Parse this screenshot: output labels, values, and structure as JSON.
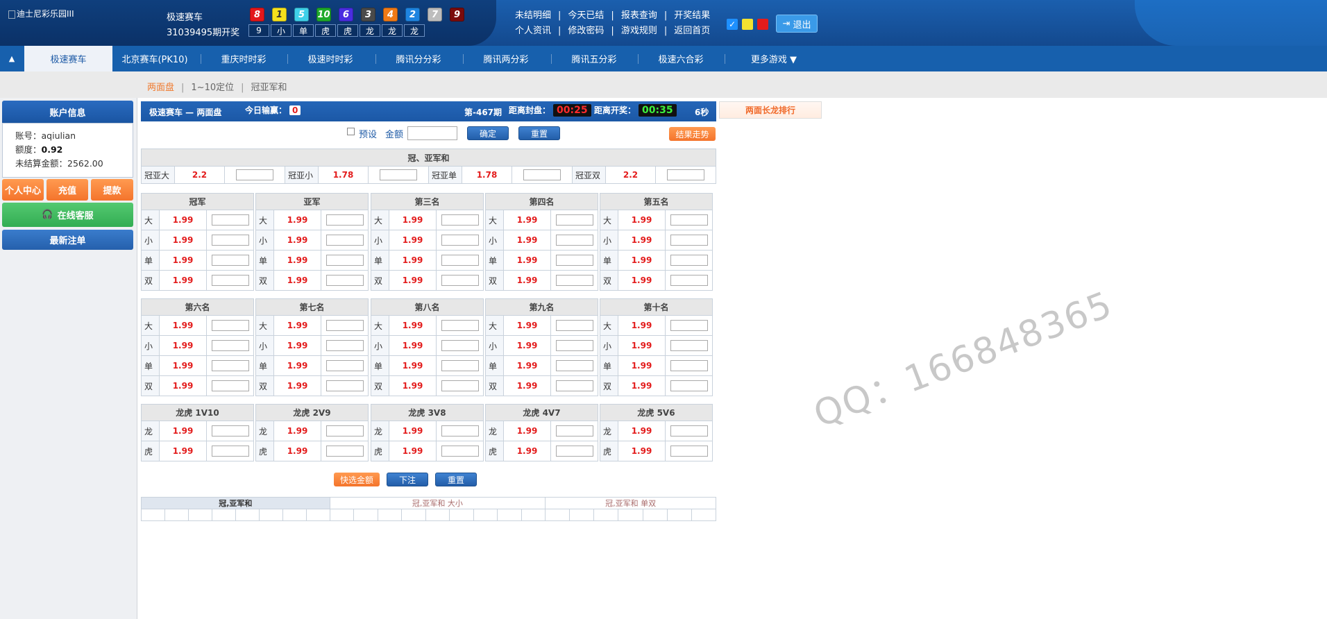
{
  "header": {
    "logo_alt": "迪士尼彩乐园III",
    "game_name": "极速赛车",
    "issue_text": "31039495期开奖",
    "balls": [
      {
        "n": "8",
        "color": "#e3171b"
      },
      {
        "n": "1",
        "color": "#f5e11d"
      },
      {
        "n": "5",
        "color": "#3fd0e9"
      },
      {
        "n": "10",
        "color": "#1faa2a"
      },
      {
        "n": "6",
        "color": "#4a2de0"
      },
      {
        "n": "3",
        "color": "#4a4a4a"
      },
      {
        "n": "4",
        "color": "#f07a16"
      },
      {
        "n": "2",
        "color": "#1e84e0"
      },
      {
        "n": "7",
        "color": "#bdbdbd"
      },
      {
        "n": "9",
        "color": "#7a0b0b"
      }
    ],
    "stats": [
      "9",
      "小",
      "单",
      "虎",
      "虎",
      "龙",
      "龙",
      "龙"
    ],
    "links_row1": [
      "未结明细",
      "今天已结",
      "报表查询",
      "开奖结果"
    ],
    "links_row2": [
      "个人资讯",
      "修改密码",
      "游戏规则",
      "返回首页"
    ],
    "swatches": [
      "#1e90ff",
      "#f2e230",
      "#e31c1c"
    ],
    "logout": "退出"
  },
  "nav": {
    "items": [
      "极速赛车",
      "北京赛车(PK10)",
      "重庆时时彩",
      "极速时时彩",
      "腾讯分分彩",
      "腾讯两分彩",
      "腾讯五分彩",
      "极速六合彩",
      "更多游戏 ▼"
    ]
  },
  "subnav": {
    "items": [
      "两面盘",
      "1~10定位",
      "冠亚军和"
    ]
  },
  "account": {
    "title": "账户信息",
    "account_label": "账号：",
    "account": "aqiulian",
    "quota_label": "额度：",
    "quota": "0.92",
    "unsettled_label": "未结算金额：",
    "unsettled": "2562.00",
    "btn_personal": "个人中心",
    "btn_deposit": "充值",
    "btn_withdraw": "提款",
    "btn_service": "在线客服",
    "btn_latest": "最新注单"
  },
  "bar": {
    "title": "极速赛车 — 两面盘",
    "today_label": "今日输赢：",
    "today_value": "0",
    "period": "第-467期",
    "close_label": "距离封盘：",
    "close_time": "00:25",
    "open_label": "距离开奖：",
    "open_time": "00:35",
    "refresh": "6秒",
    "long_dragon": "两面长龙排行"
  },
  "controls": {
    "preset": "预设",
    "amount": "金额",
    "confirm": "确定",
    "reset": "重置",
    "trend": "结果走势",
    "quick": "快选金额",
    "bet": "下注",
    "reset2": "重置"
  },
  "guanya": {
    "title": "冠、亚军和",
    "items": [
      {
        "label": "冠亚大",
        "odds": "2.2"
      },
      {
        "label": "冠亚小",
        "odds": "1.78"
      },
      {
        "label": "冠亚单",
        "odds": "1.78"
      },
      {
        "label": "冠亚双",
        "odds": "2.2"
      }
    ]
  },
  "positions1": {
    "titles": [
      "冠军",
      "亚军",
      "第三名",
      "第四名",
      "第五名"
    ],
    "rows": [
      {
        "label": "大",
        "odds": "1.99"
      },
      {
        "label": "小",
        "odds": "1.99"
      },
      {
        "label": "单",
        "odds": "1.99"
      },
      {
        "label": "双",
        "odds": "1.99"
      }
    ]
  },
  "positions2": {
    "titles": [
      "第六名",
      "第七名",
      "第八名",
      "第九名",
      "第十名"
    ],
    "rows": [
      {
        "label": "大",
        "odds": "1.99"
      },
      {
        "label": "小",
        "odds": "1.99"
      },
      {
        "label": "单",
        "odds": "1.99"
      },
      {
        "label": "双",
        "odds": "1.99"
      }
    ]
  },
  "dragon": {
    "titles": [
      "龙虎 1V10",
      "龙虎 2V9",
      "龙虎 3V8",
      "龙虎 4V7",
      "龙虎 5V6"
    ],
    "rows": [
      {
        "label": "龙",
        "odds": "1.99"
      },
      {
        "label": "虎",
        "odds": "1.99"
      }
    ]
  },
  "results": {
    "headers": [
      "冠,亚军和",
      "冠,亚军和 大小",
      "冠,亚军和 单双"
    ]
  },
  "watermark": "QQ：166848365"
}
